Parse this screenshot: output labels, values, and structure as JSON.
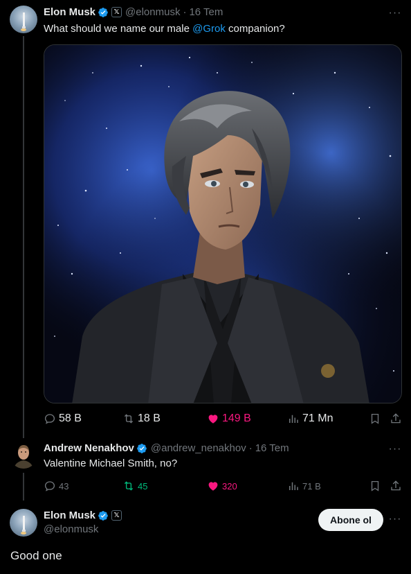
{
  "tweets": [
    {
      "name": "Elon Musk",
      "handle": "@elonmusk",
      "date": "16 Tem",
      "text_prefix": "What should we name our male ",
      "mention": "@Grok",
      "text_suffix": " companion?",
      "stats": {
        "replies": "58 B",
        "reposts": "18 B",
        "likes": "149 B",
        "views": "71 Mn"
      }
    },
    {
      "name": "Andrew Nenakhov",
      "handle": "@andrew_nenakhov",
      "date": "16 Tem",
      "text": "Valentine Michael Smith, no?",
      "stats": {
        "replies": "43",
        "reposts": "45",
        "likes": "320",
        "views": "71 B"
      }
    }
  ],
  "focused": {
    "name": "Elon Musk",
    "handle": "@elonmusk",
    "follow_label": "Abone ol",
    "text": "Good one"
  },
  "colors": {
    "background": "#000000",
    "text": "#e7e9ea",
    "muted": "#71767b",
    "accent_blue": "#1d9bf0",
    "like_pink": "#f91880",
    "repost_green": "#00ba7c"
  },
  "icons": [
    "verified-badge-icon",
    "x-affiliate-badge-icon",
    "more-icon",
    "reply-icon",
    "repost-icon",
    "like-icon",
    "views-icon",
    "bookmark-icon",
    "share-icon"
  ]
}
